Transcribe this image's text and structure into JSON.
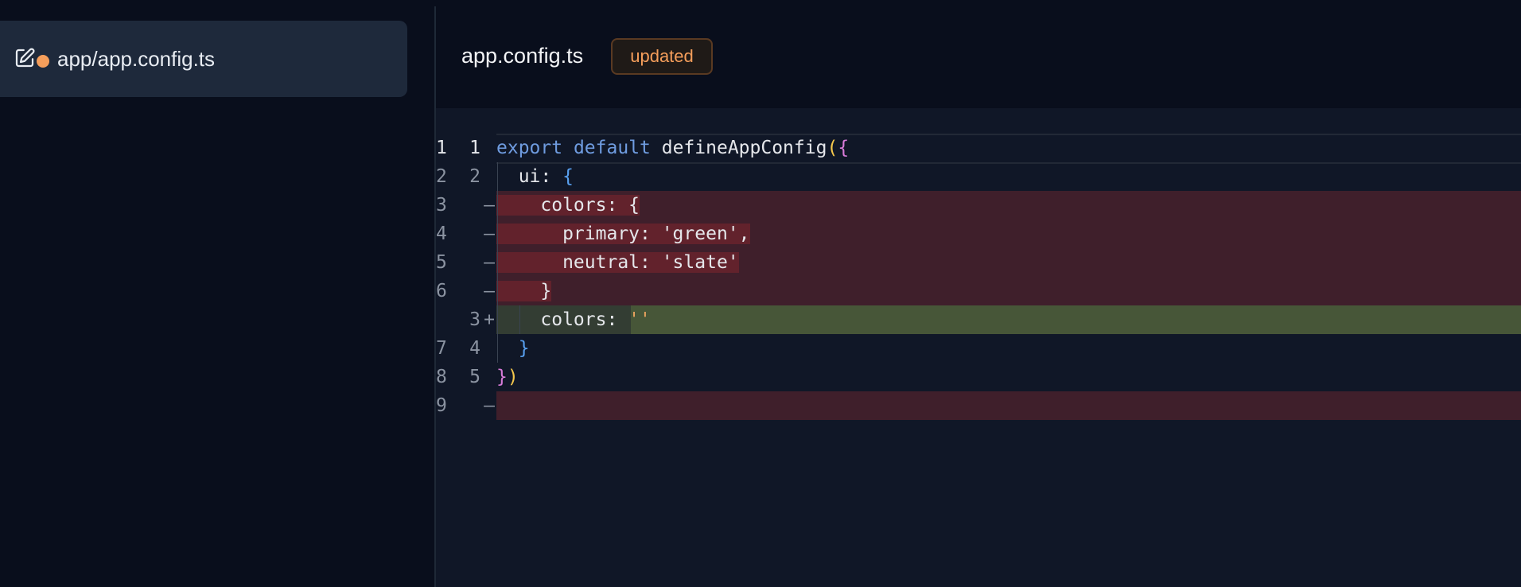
{
  "colors": {
    "accent_orange": "#f59e5b",
    "badge_text": "#f59e5b",
    "delete_bg": "#62222c",
    "add_bg": "#475638"
  },
  "sidebar": {
    "items": [
      {
        "label": "app/app.config.ts",
        "icon": "edit-square-icon",
        "status_dot": "modified-dot"
      }
    ]
  },
  "header": {
    "title": "app.config.ts",
    "badge": "updated"
  },
  "diff": {
    "lines": [
      {
        "old": "1",
        "new": "1",
        "marker": "",
        "type": "context",
        "tokens": [
          {
            "t": "export",
            "c": "kw"
          },
          {
            "t": " ",
            "c": "id"
          },
          {
            "t": "default",
            "c": "kw"
          },
          {
            "t": " defineAppConfig",
            "c": "fn"
          },
          {
            "t": "(",
            "c": "p1"
          },
          {
            "t": "{",
            "c": "p2"
          }
        ]
      },
      {
        "old": "2",
        "new": "2",
        "marker": "",
        "type": "context",
        "tokens": [
          {
            "t": "  ui: ",
            "c": "id"
          },
          {
            "t": "{",
            "c": "p3"
          }
        ]
      },
      {
        "old": "3",
        "new": "",
        "marker": "—",
        "type": "delete",
        "tokens": [
          {
            "t": "    colors: {",
            "c": "id"
          }
        ]
      },
      {
        "old": "4",
        "new": "",
        "marker": "—",
        "type": "delete",
        "tokens": [
          {
            "t": "      primary: 'green',",
            "c": "id"
          }
        ]
      },
      {
        "old": "5",
        "new": "",
        "marker": "—",
        "type": "delete",
        "tokens": [
          {
            "t": "      neutral: 'slate'",
            "c": "id"
          }
        ]
      },
      {
        "old": "6",
        "new": "",
        "marker": "—",
        "type": "delete",
        "tokens": [
          {
            "t": "    }",
            "c": "id"
          }
        ]
      },
      {
        "old": "",
        "new": "3",
        "marker": "+",
        "type": "add",
        "tokens": [
          {
            "t": "    colors: ",
            "c": "id"
          },
          {
            "t": "''",
            "c": "stradd"
          }
        ]
      },
      {
        "old": "7",
        "new": "4",
        "marker": "",
        "type": "context",
        "tokens": [
          {
            "t": "  ",
            "c": "id"
          },
          {
            "t": "}",
            "c": "p3"
          }
        ]
      },
      {
        "old": "8",
        "new": "5",
        "marker": "",
        "type": "context",
        "tokens": [
          {
            "t": "}",
            "c": "p2"
          },
          {
            "t": ")",
            "c": "p1"
          }
        ]
      },
      {
        "old": "9",
        "new": "",
        "marker": "—",
        "type": "delete-empty",
        "tokens": []
      }
    ]
  }
}
